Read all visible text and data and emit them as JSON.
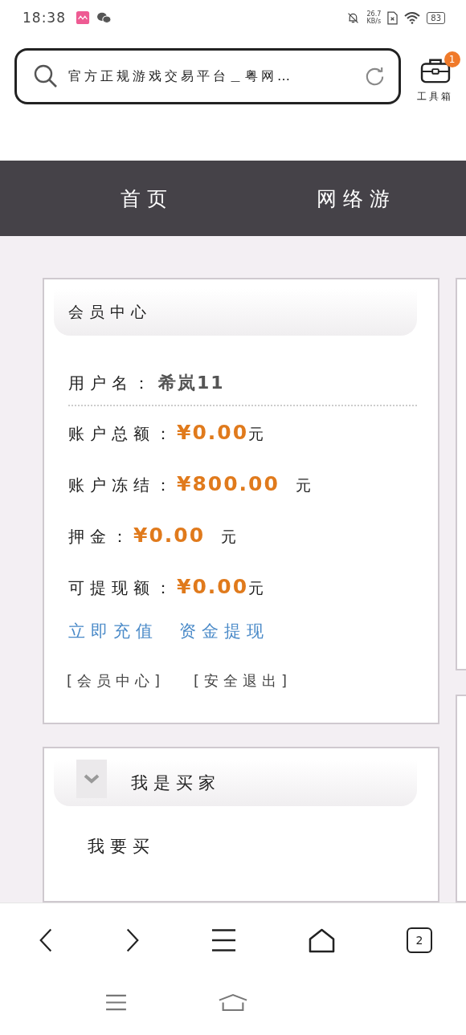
{
  "status_bar": {
    "time": "18:38",
    "net_speed": "26.7",
    "net_unit": "KB/s",
    "battery": "83"
  },
  "address_bar": {
    "title": "官方正规游戏交易平台＿粤网…",
    "toolbox_label": "工具箱",
    "toolbox_badge": "1"
  },
  "nav_tabs": [
    "首页",
    "网络游"
  ],
  "member_card": {
    "title": "会员中心",
    "username_label": "用户名：",
    "username": "希岚11",
    "balances": [
      {
        "label": "账户总额：",
        "amount": "¥0.00",
        "unit": "元"
      },
      {
        "label": "账户冻结：",
        "amount": "¥800.00",
        "unit": "元"
      },
      {
        "label": "押金：",
        "amount": "¥0.00",
        "unit": "元"
      },
      {
        "label": "可提现额：",
        "amount": "¥0.00",
        "unit": "元"
      }
    ],
    "actions": [
      "立即充值",
      "资金提现"
    ],
    "footer_links": [
      "[会员中心]",
      "[安全退出]"
    ]
  },
  "buyer_card": {
    "title": "我是买家",
    "items": [
      "我要买"
    ]
  },
  "browser_toolbar": {
    "tab_count": "2"
  }
}
